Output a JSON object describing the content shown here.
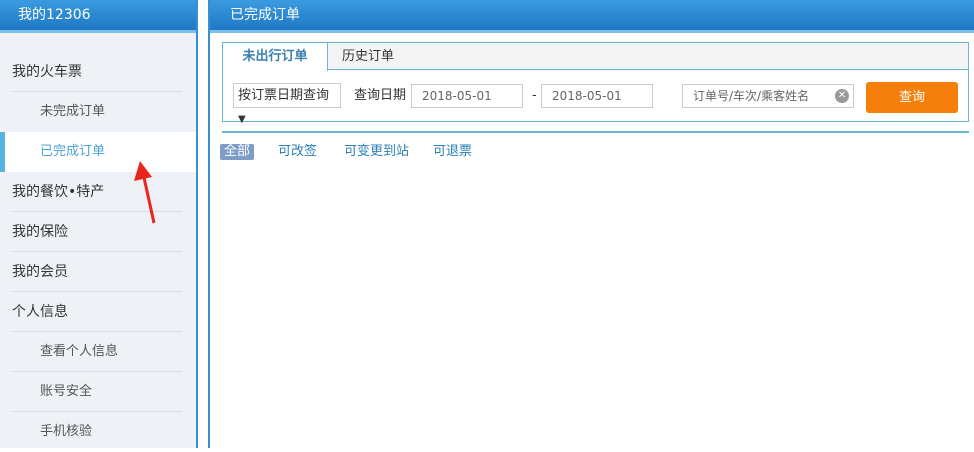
{
  "sidebar": {
    "title": "我的12306",
    "items": [
      {
        "label": "我的火车票"
      },
      {
        "label": "未完成订单"
      },
      {
        "label": "已完成订单"
      },
      {
        "label": "我的餐饮•特产"
      },
      {
        "label": "我的保险"
      },
      {
        "label": "我的会员"
      },
      {
        "label": "个人信息"
      },
      {
        "label": "查看个人信息"
      },
      {
        "label": "账号安全"
      },
      {
        "label": "手机核验"
      }
    ]
  },
  "main": {
    "title": "已完成订单",
    "tabs": [
      {
        "label": "未出行订单"
      },
      {
        "label": "历史订单"
      }
    ],
    "query_type": "按订票日期查询",
    "date_label": "查询日期",
    "start_date": "2018-05-01",
    "separator": "-",
    "end_date": "2018-05-01",
    "search_placeholder": "订单号/车次/乘客姓名",
    "search_button": "查询",
    "filters": [
      {
        "label": "全部"
      },
      {
        "label": "可改签"
      },
      {
        "label": "可变更到站"
      },
      {
        "label": "可退票"
      }
    ]
  },
  "colors": {
    "accent": "#2a7fb5",
    "button": "#f57f0c",
    "annotation": "#e8261c"
  }
}
